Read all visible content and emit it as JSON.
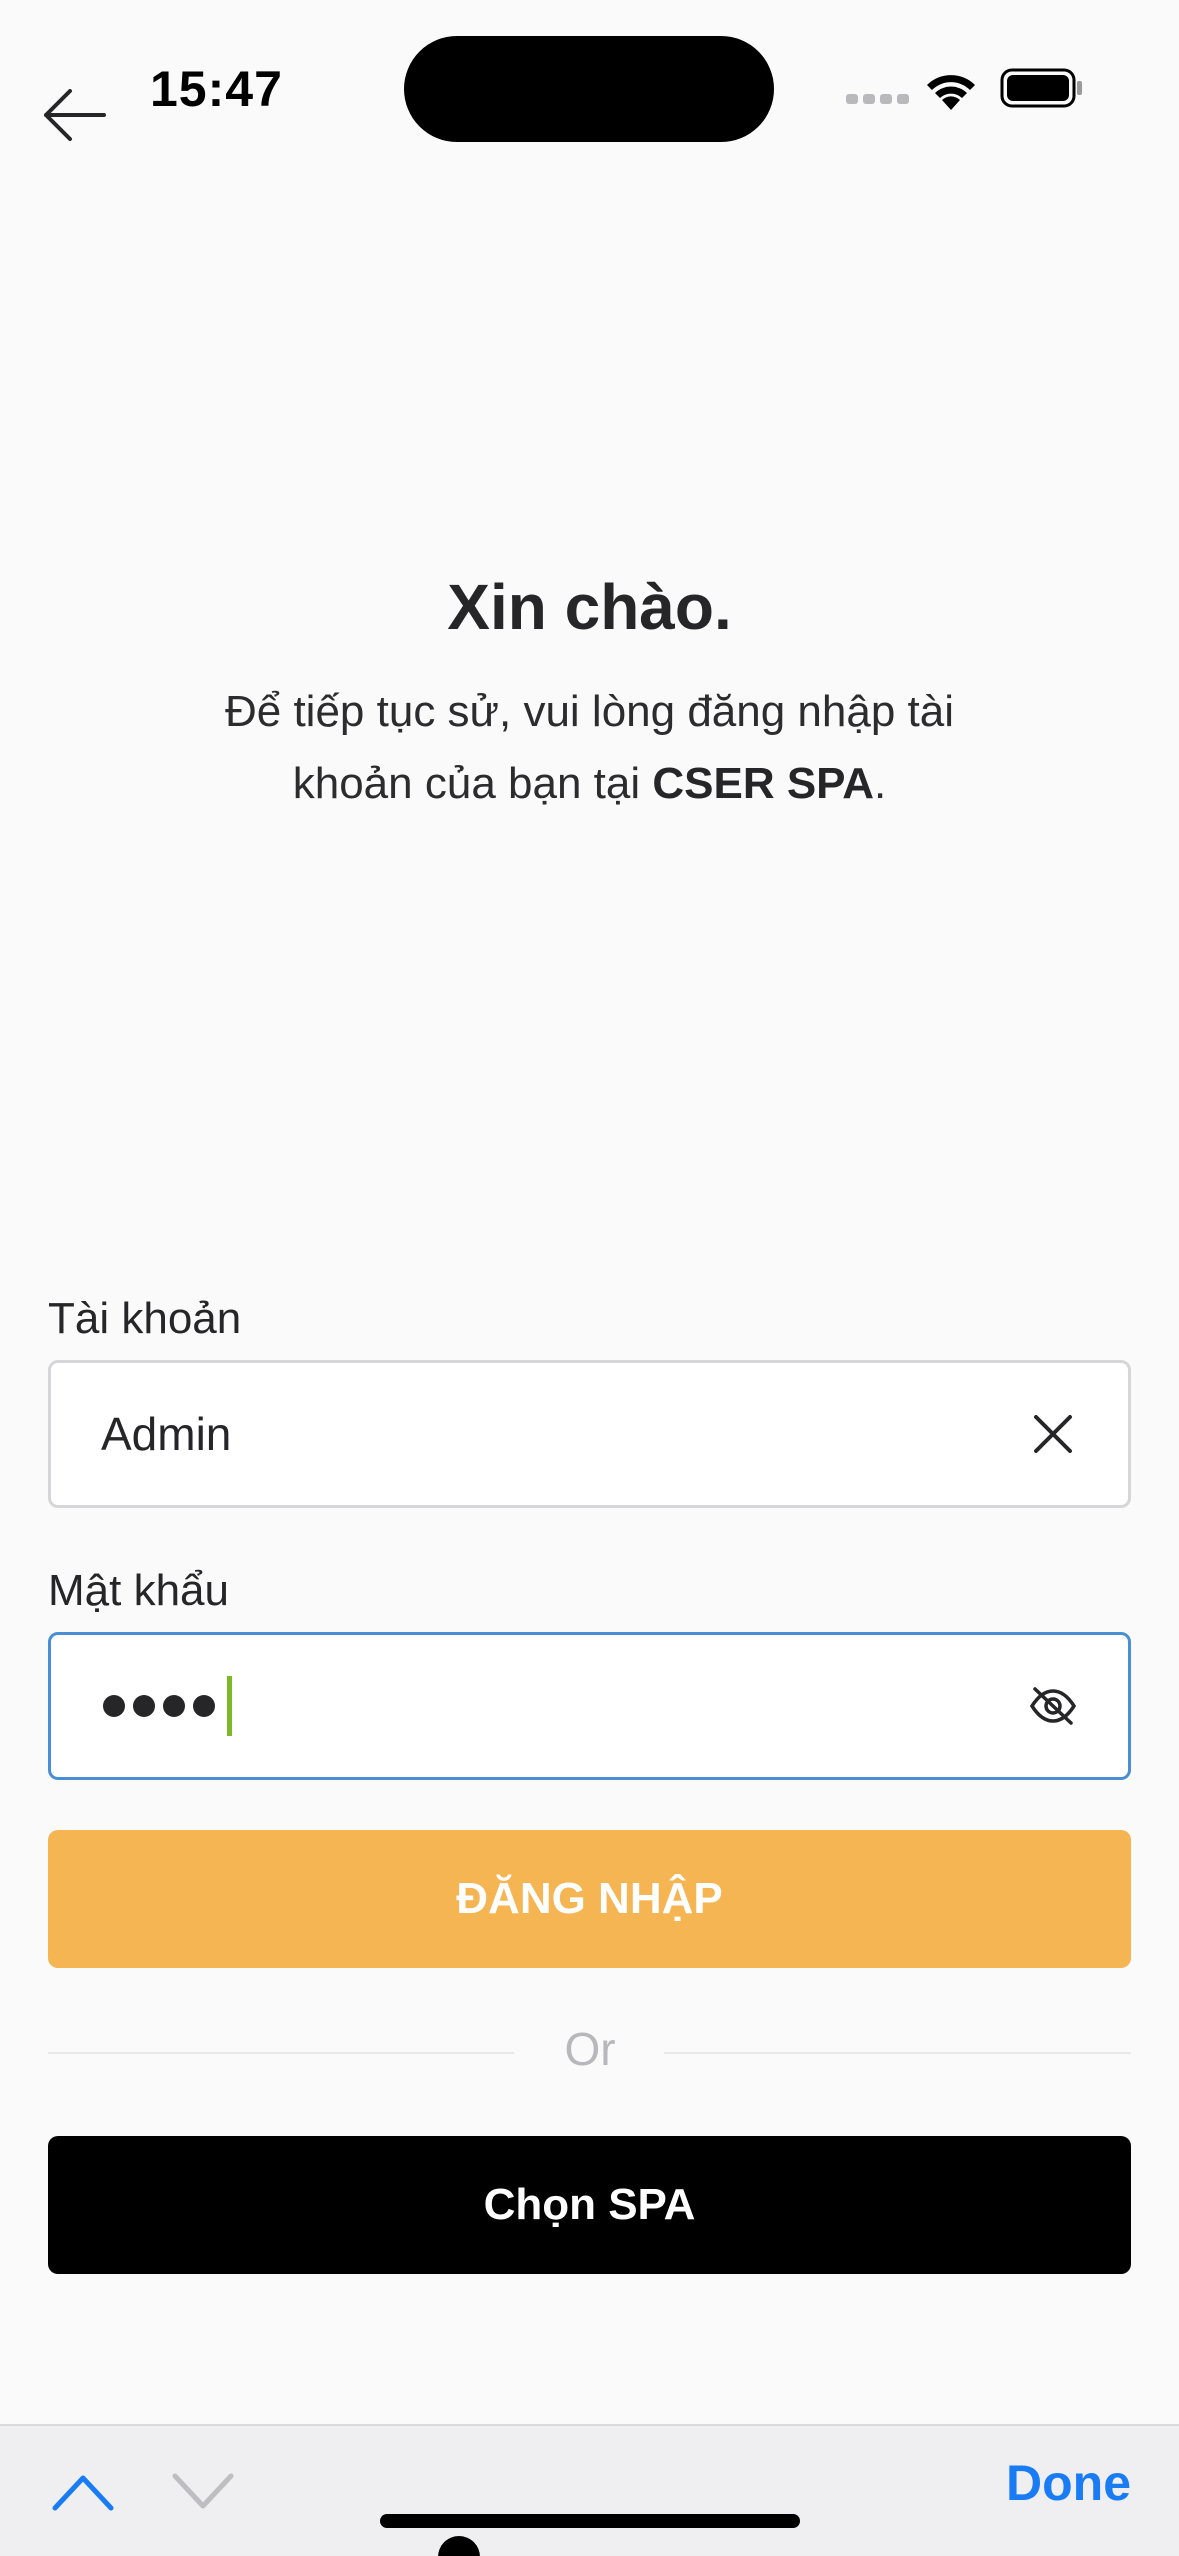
{
  "status_bar": {
    "time": "15:47"
  },
  "header": {
    "greeting": "Xin chào.",
    "subtitle_line1": "Để tiếp tục sử, vui lòng đăng nhập tài",
    "subtitle_line2_prefix": "khoản của bạn tại ",
    "subtitle_brand": "CSER SPA",
    "subtitle_suffix": "."
  },
  "form": {
    "username_label": "Tài khoản",
    "username_value": "Admin",
    "password_label": "Mật khẩu",
    "password_masked_length": 4,
    "login_button": "ĐĂNG NHẬP",
    "or_text": "Or",
    "choose_spa_button": "Chọn SPA"
  },
  "keyboard_toolbar": {
    "done_label": "Done"
  },
  "colors": {
    "login_button": "#f5b552",
    "spa_button": "#000000",
    "active_border": "#4a8fd6",
    "done_text": "#1a7cf5",
    "caret": "#7fb827"
  }
}
